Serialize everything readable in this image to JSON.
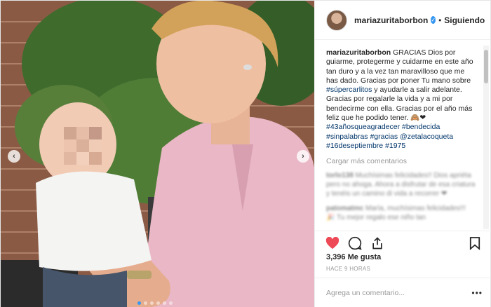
{
  "post": {
    "photo_alt_icon": "post-photo",
    "prev_arrow": "‹",
    "next_arrow": "›",
    "carousel_dots": 6,
    "carousel_active": 0
  },
  "header": {
    "username": "mariazuritaborbon",
    "verified_icon": "verified-badge-icon",
    "separator": "•",
    "follow_status": "Siguiendo"
  },
  "caption": {
    "username": "mariazuritaborbon",
    "text_1": " GRACIAS Dios por guiarme, protegerme y cuidarme en este año tan duro y a la vez tan maravilloso que me has dado. Gracias por poner Tu mano sobre ",
    "tag_1": "#súpercarlitos",
    "text_2": " y ayudarle a salir adelante. Gracias por regalarle la vida y a mi por bendecirme con ella. Gracias por el año más feliz que he podido tener. 🙈❤",
    "tags_2": "#43añosqueagradecer #bendecida #sinpalabras #gracias @zetalacoqueta #16deseptiembre #1975"
  },
  "load_more": "Cargar más comentarios",
  "comments": [
    {
      "username": "torlo138",
      "text": " Muchísimas felicidades!! Dios apriéta pero no ahoga. Ahora a disfrutar de esa criatura y tenéis un camino di vida a recorrer ❤"
    },
    {
      "username": "patomatmc",
      "text": " María, muchísimas felicidades!!! 🎉 Tu mejor regalo ese niño tan"
    }
  ],
  "actions": {
    "like_icon": "heart-icon",
    "comment_icon": "comment-icon",
    "share_icon": "share-icon",
    "save_icon": "bookmark-icon",
    "like_color": "#ed4956"
  },
  "likes": "3,396 Me gusta",
  "timestamp": "HACE 9 HORAS",
  "add_comment": {
    "placeholder": "Agrega un comentario...",
    "more": "•••"
  }
}
